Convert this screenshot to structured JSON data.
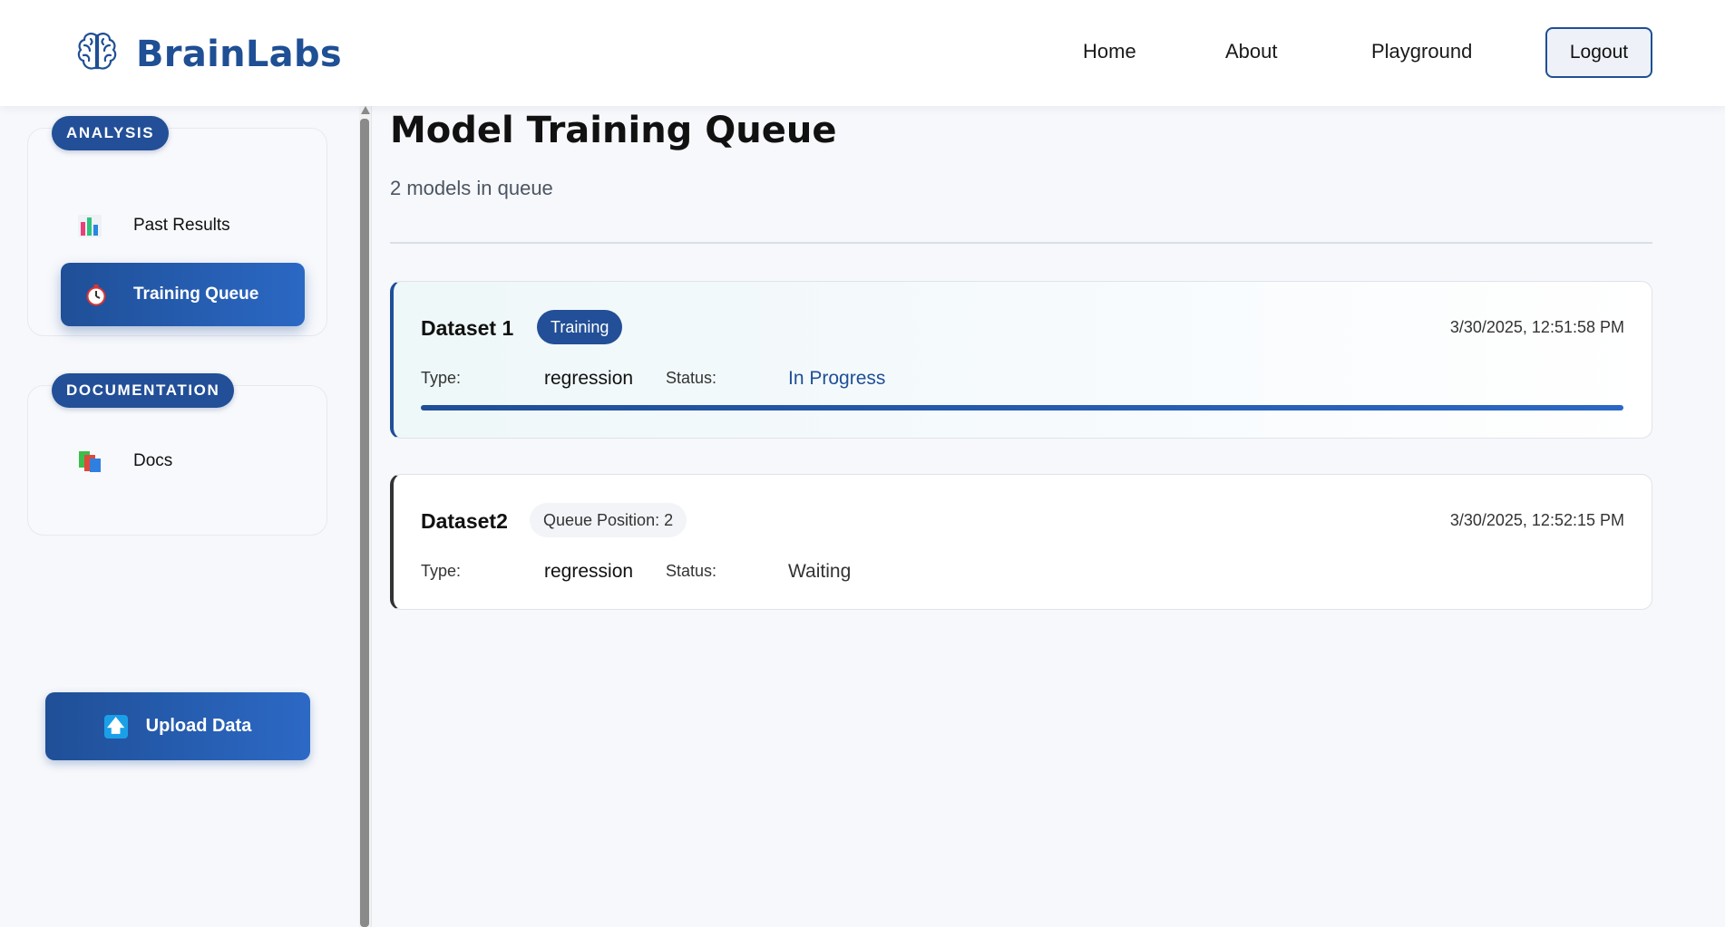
{
  "app": {
    "name": "BrainLabs"
  },
  "nav": {
    "home": "Home",
    "about": "About",
    "playground": "Playground",
    "logout": "Logout"
  },
  "sidebar": {
    "analysis_title": "ANALYSIS",
    "past_results": "Past Results",
    "training_queue": "Training Queue",
    "documentation_title": "DOCUMENTATION",
    "docs": "Docs",
    "upload": "Upload Data"
  },
  "main": {
    "title": "Model Training Queue",
    "subtitle": "2 models in queue"
  },
  "jobs": [
    {
      "name": "Dataset 1",
      "badge": "Training",
      "timestamp": "3/30/2025, 12:51:58 PM",
      "type_label": "Type:",
      "type": "regression",
      "status_label": "Status:",
      "status": "In Progress",
      "progress": 100
    },
    {
      "name": "Dataset2",
      "badge": "Queue Position: 2",
      "timestamp": "3/30/2025, 12:52:15 PM",
      "type_label": "Type:",
      "type": "regression",
      "status_label": "Status:",
      "status": "Waiting"
    }
  ],
  "colors": {
    "brand": "#1f4f94",
    "accent": "#224f97",
    "background": "#f7f8fb"
  },
  "icons": {
    "logo": "brain-icon",
    "past_results": "bar-chart-icon",
    "training_queue": "stopwatch-icon",
    "docs": "books-icon",
    "upload": "upload-arrow-icon"
  }
}
